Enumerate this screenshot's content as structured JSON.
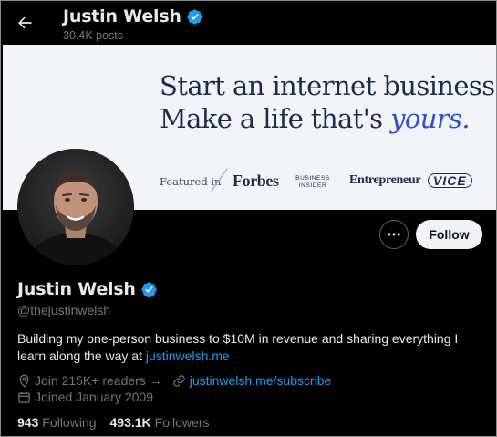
{
  "header": {
    "name": "Justin Welsh",
    "posts": "30.4K posts"
  },
  "banner": {
    "line1": "Start an internet business.",
    "line2_prefix": "Make a life that's ",
    "line2_accent": "yours.",
    "featured_label": "Featured in",
    "logos": {
      "forbes": "Forbes",
      "business_insider_1": "BUSINESS",
      "business_insider_2": "INSIDER",
      "entrepreneur": "Entrepreneur",
      "vice": "VICE"
    }
  },
  "actions": {
    "follow": "Follow"
  },
  "profile": {
    "name": "Justin Welsh",
    "handle": "@thejustinwelsh",
    "bio_text": "Building my one-person business to $10M in revenue and sharing everything I learn along the way at ",
    "bio_link": "justinwelsh.me",
    "location": "Join 215K+ readers →",
    "website": "justinwelsh.me/subscribe",
    "joined": "Joined January 2009"
  },
  "stats": {
    "following_count": "943",
    "following_label": "Following",
    "followers_count": "493.1K",
    "followers_label": "Followers"
  },
  "colors": {
    "background": "#000000",
    "verified": "#1d9bf0",
    "link": "#1d9bf0",
    "banner_bg": "#f2f4f8",
    "banner_text": "#1f2a4d",
    "banner_accent": "#2c4fd6"
  },
  "icons": [
    "back-arrow-icon",
    "verified-badge-icon",
    "more-options-icon",
    "location-icon",
    "link-icon",
    "calendar-icon"
  ]
}
